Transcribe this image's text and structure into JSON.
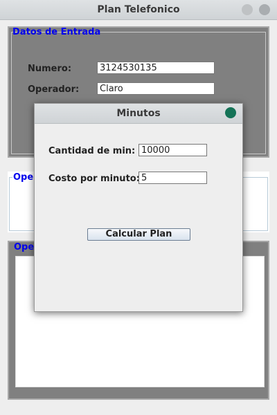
{
  "window": {
    "title": "Plan Telefonico"
  },
  "entrada": {
    "legend": "Datos de Entrada",
    "numero_label": "Numero:",
    "numero_value": "3124530135",
    "operador_label": "Operador:",
    "operador_value": "Claro"
  },
  "operador_panel": {
    "legend": "Oper"
  },
  "operaciones_panel": {
    "legend": "Oper"
  },
  "dialog": {
    "title": "Minutos",
    "cantidad_label": "Cantidad de min:",
    "cantidad_value": "10000",
    "costo_label": "Costo por minuto:",
    "costo_value": "5",
    "button_label": "Calcular Plan",
    "close_color": "#157357"
  }
}
